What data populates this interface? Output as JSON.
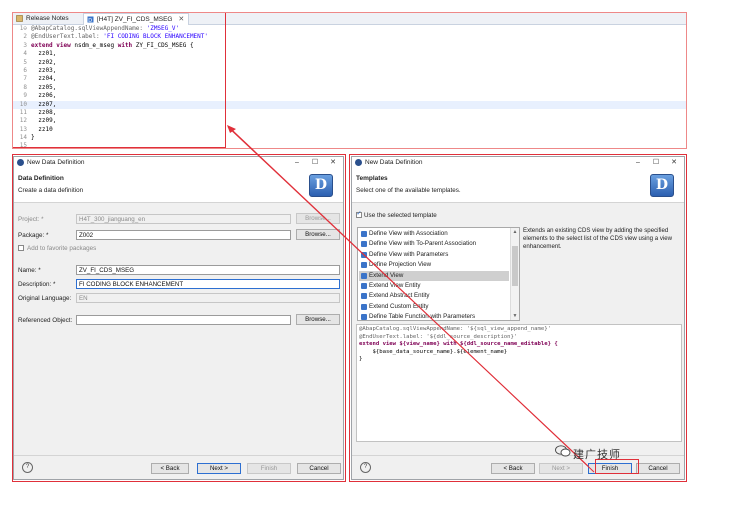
{
  "editor": {
    "tabs": [
      {
        "label": "Release Notes",
        "active": false
      },
      {
        "label": "[H4T] ZV_FI_CDS_MSEG",
        "active": true,
        "close": "✕"
      }
    ],
    "lines": [
      {
        "n": "1⊖",
        "parts": [
          {
            "t": "@AbapCatalog.sqlViewAppendName: ",
            "c": "ann"
          },
          {
            "t": "'ZMSEG_V'",
            "c": "str"
          }
        ]
      },
      {
        "n": "2",
        "parts": [
          {
            "t": "@EndUserText.label: ",
            "c": "ann"
          },
          {
            "t": "'FI CODING BLOCK ENHANCEMENT'",
            "c": "str"
          }
        ]
      },
      {
        "n": "3",
        "parts": [
          {
            "t": "extend view ",
            "c": "kw"
          },
          {
            "t": "nsdm_e_mseg ",
            "c": "id"
          },
          {
            "t": "with ",
            "c": "kw"
          },
          {
            "t": "ZY_FI_CDS_MSEG {",
            "c": "id"
          }
        ]
      },
      {
        "n": "4",
        "parts": [
          {
            "t": "zz01,",
            "c": "id"
          }
        ]
      },
      {
        "n": "5",
        "parts": [
          {
            "t": "zz02,",
            "c": "id"
          }
        ]
      },
      {
        "n": "6",
        "parts": [
          {
            "t": "zz03,",
            "c": "id"
          }
        ]
      },
      {
        "n": "7",
        "parts": [
          {
            "t": "zz04,",
            "c": "id"
          }
        ]
      },
      {
        "n": "8",
        "parts": [
          {
            "t": "zz05,",
            "c": "id"
          }
        ]
      },
      {
        "n": "9",
        "parts": [
          {
            "t": "zz06,",
            "c": "id"
          }
        ]
      },
      {
        "n": "10",
        "parts": [
          {
            "t": "zz07,",
            "c": "id"
          }
        ],
        "highlight": true
      },
      {
        "n": "11",
        "parts": [
          {
            "t": "zz08,",
            "c": "id"
          }
        ]
      },
      {
        "n": "12",
        "parts": [
          {
            "t": "zz09,",
            "c": "id"
          }
        ]
      },
      {
        "n": "13",
        "parts": [
          {
            "t": "zz10",
            "c": "id"
          }
        ]
      },
      {
        "n": "14",
        "parts": [
          {
            "t": "}",
            "c": "id"
          }
        ]
      },
      {
        "n": "15",
        "parts": []
      }
    ]
  },
  "left_dialog": {
    "title": "New Data Definition",
    "window_buttons": {
      "minimize": "–",
      "maximize": "☐",
      "close": "✕"
    },
    "header_title": "Data Definition",
    "header_subtitle": "Create a data definition",
    "logo": "D",
    "project_label": "Project: *",
    "project_value": "H4T_300_jianguang_en",
    "project_browse": "Browse...",
    "package_label": "Package: *",
    "package_value": "Z002",
    "package_browse": "Browse...",
    "favorite_label": "Add to favorite packages",
    "name_label": "Name: *",
    "name_value": "ZV_FI_CDS_MSEG",
    "description_label": "Description: *",
    "description_value": "FI CODING BLOCK ENHANCEMENT",
    "language_label": "Original Language:",
    "language_value": "EN",
    "ref_label": "Referenced Object:",
    "ref_value": "",
    "ref_browse": "Browse...",
    "help": "?",
    "back": "< Back",
    "next": "Next >",
    "finish": "Finish",
    "cancel": "Cancel"
  },
  "right_dialog": {
    "title": "New Data Definition",
    "window_buttons": {
      "minimize": "–",
      "maximize": "☐",
      "close": "✕"
    },
    "header_title": "Templates",
    "header_subtitle": "Select one of the available templates.",
    "logo": "D",
    "use_template_label": "Use the selected template",
    "templates": [
      {
        "label": "Define View with Association",
        "selected": false
      },
      {
        "label": "Define View with To-Parent Association",
        "selected": false
      },
      {
        "label": "Define View with Parameters",
        "selected": false
      },
      {
        "label": "Define Projection View",
        "selected": false
      },
      {
        "label": "Extend View",
        "selected": true
      },
      {
        "label": "Extend View Entity",
        "selected": false
      },
      {
        "label": "Extend Abstract Entity",
        "selected": false
      },
      {
        "label": "Extend Custom Entity",
        "selected": false
      },
      {
        "label": "Define Table Function with Parameters",
        "selected": false
      }
    ],
    "scroll_up": "▲",
    "scroll_down": "▼",
    "description": "Extends an existing CDS view by adding the specified elements to the select list of the CDS view using a view enhancement.",
    "template_code": [
      "@AbapCatalog.sqlViewAppendName: '${sql_view_append_name}'",
      "@EndUserText.label: '${ddl_source_description}'",
      "extend view ${view_name} with ${ddl_source_name_editable} {",
      "    ${base_data_source_name}.${element_name}",
      "}"
    ],
    "help": "?",
    "back": "< Back",
    "next": "Next >",
    "finish": "Finish",
    "cancel": "Cancel"
  },
  "watermark": "建广技师",
  "colors": {
    "highlight_frame": "#e0303a",
    "keyword": "#7f0055",
    "string": "#2a00ff",
    "annotation": "#646464"
  }
}
